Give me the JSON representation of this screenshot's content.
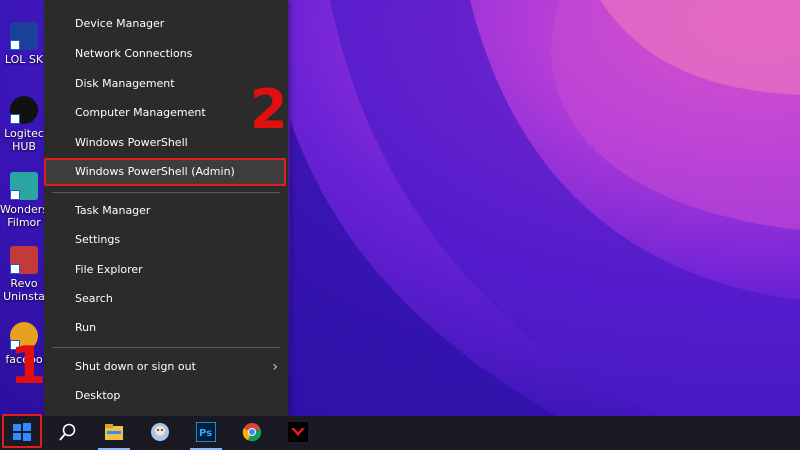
{
  "desktop": {
    "icons": [
      {
        "label": "LOL SK",
        "color": "#1d3f9c"
      },
      {
        "label": "Logitec HUB",
        "color": "#111111"
      },
      {
        "label": "Wonders Filmor",
        "color": "#2aa6a0"
      },
      {
        "label": "Revo Uninsta",
        "color": "#c23a3a"
      },
      {
        "label": "facebo",
        "color": "#e8a020"
      }
    ]
  },
  "menu": {
    "items": [
      {
        "label": "Device Manager"
      },
      {
        "label": "Network Connections"
      },
      {
        "label": "Disk Management"
      },
      {
        "label": "Computer Management"
      },
      {
        "label": "Windows PowerShell"
      },
      {
        "label": "Windows PowerShell (Admin)",
        "highlighted": true
      },
      {
        "label": "Task Manager"
      },
      {
        "label": "Settings"
      },
      {
        "label": "File Explorer"
      },
      {
        "label": "Search"
      },
      {
        "label": "Run"
      },
      {
        "label": "Shut down or sign out",
        "has_submenu": true
      },
      {
        "label": "Desktop"
      }
    ],
    "chevron": "›"
  },
  "markers": {
    "step1": "1",
    "step2": "2"
  },
  "taskbar": {
    "items": [
      {
        "name": "start-icon",
        "label": "Start"
      },
      {
        "name": "search-icon",
        "label": "Search"
      },
      {
        "name": "file-explorer-icon",
        "label": "File Explorer"
      },
      {
        "name": "app-avatar-icon",
        "label": "App"
      },
      {
        "name": "photoshop-icon",
        "label": "Ps"
      },
      {
        "name": "chrome-icon",
        "label": "Chrome"
      },
      {
        "name": "game-app-icon",
        "label": "Game"
      }
    ]
  },
  "colors": {
    "accent_red": "#e01e1e",
    "menu_bg": "#2b2b2b",
    "taskbar_bg": "#1a1a24"
  }
}
